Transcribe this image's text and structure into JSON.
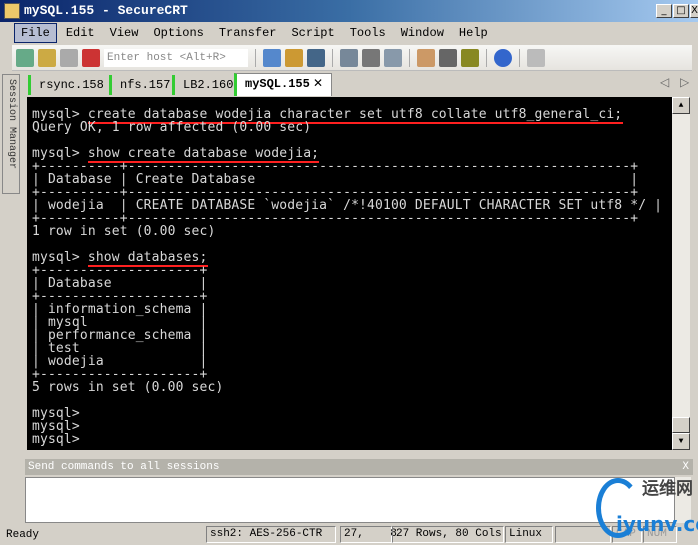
{
  "window": {
    "title": "mySQL.155 - SecureCRT",
    "minimize": "_",
    "maximize": "□",
    "close": "X"
  },
  "menu": [
    "File",
    "Edit",
    "View",
    "Options",
    "Transfer",
    "Script",
    "Tools",
    "Window",
    "Help"
  ],
  "toolbar": {
    "host_placeholder": "Enter host <Alt+R>",
    "icons": [
      "connect-icon",
      "quick-connect-icon",
      "reconnect-icon",
      "disconnect-icon",
      "copy-icon",
      "paste-icon",
      "find-icon",
      "print-setup-icon",
      "print-screen-icon",
      "print-icon",
      "session-options-icon",
      "sftp-icon",
      "key-icon",
      "help-icon",
      "lock-icon"
    ]
  },
  "sidebar": {
    "label": "Session Manager"
  },
  "tabs": [
    {
      "label": "rsync.158"
    },
    {
      "label": "nfs.157"
    },
    {
      "label": "LB2.160"
    },
    {
      "label": "mySQL.155",
      "close": "✕"
    }
  ],
  "tab_nav": {
    "prev": "◁",
    "next": "▷"
  },
  "terminal": {
    "lines": [
      "mysql> create database wodejia character set utf8 collate utf8_general_ci;",
      "Query OK, 1 row affected (0.00 sec)",
      "",
      "mysql> show create database wodejia;",
      "+----------+---------------------------------------------------------------+",
      "| Database | Create Database                                               |",
      "+----------+---------------------------------------------------------------+",
      "| wodejia  | CREATE DATABASE `wodejia` /*!40100 DEFAULT CHARACTER SET utf8 */ |",
      "+----------+---------------------------------------------------------------+",
      "1 row in set (0.00 sec)",
      "",
      "mysql> show databases;",
      "+--------------------+",
      "| Database           |",
      "+--------------------+",
      "| information_schema |",
      "| mysql              |",
      "| performance_schema |",
      "| test               |",
      "| wodejia            |",
      "+--------------------+",
      "5 rows in set (0.00 sec)",
      "",
      "mysql>",
      "mysql>",
      "mysql>"
    ],
    "underline_color": "#ff2020"
  },
  "send_commands": {
    "header": "Send commands to all sessions",
    "close": "X"
  },
  "status": {
    "ready": "Ready",
    "cipher": "ssh2: AES-256-CTR",
    "position": "27,    8",
    "size": "27 Rows, 80 Cols",
    "os": "Linux",
    "cap": "CAP",
    "num": "NUM"
  },
  "watermark": {
    "text": "运维网",
    "domain": "iyunv.com"
  }
}
